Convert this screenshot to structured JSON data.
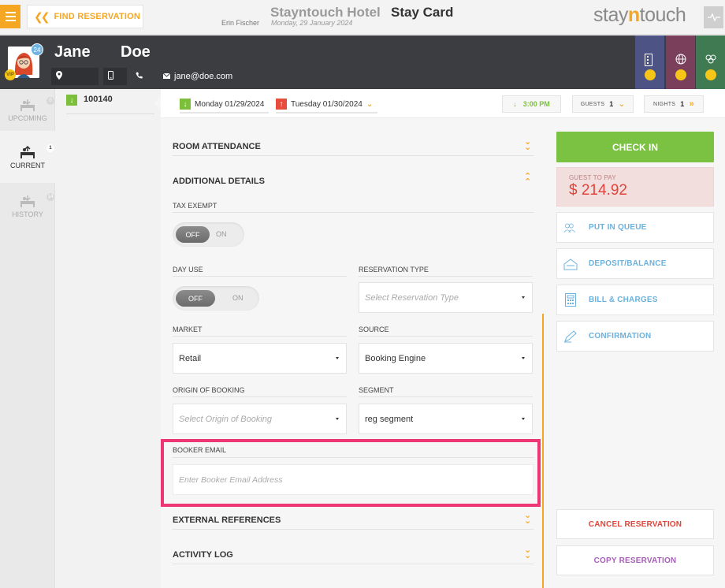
{
  "topbar": {
    "find_reservation": "FIND RESERVATION",
    "hotel_name": "Stayntouch Hotel",
    "page_title": "Stay Card",
    "user_name": "Erin Fischer",
    "current_date": "Monday, 29 January 2024",
    "logo_prefix": "stay",
    "logo_n": "n",
    "logo_suffix": "touch"
  },
  "guest": {
    "first_name": "Jane",
    "last_name": "Doe",
    "email": "jane@doe.com",
    "stay_count": "24",
    "vip": "VIP"
  },
  "sidebar": {
    "items": [
      {
        "label": "UPCOMING",
        "count": "0"
      },
      {
        "label": "CURRENT",
        "count": "1"
      },
      {
        "label": "HISTORY",
        "count": "14"
      }
    ]
  },
  "reservation_list": {
    "number": "100140"
  },
  "datebar": {
    "arrival": "Monday 01/29/2024",
    "departure": "Tuesday 01/30/2024",
    "arrival_time": "3:00 PM",
    "guests_label": "GUESTS",
    "guests_value": "1",
    "nights_label": "NIGHTS",
    "nights_value": "1"
  },
  "sections": {
    "room_attendance": "ROOM ATTENDANCE",
    "additional_details": "ADDITIONAL DETAILS",
    "external_references": "EXTERNAL REFERENCES",
    "activity_log": "ACTIVITY LOG"
  },
  "form": {
    "tax_exempt_label": "TAX EXEMPT",
    "day_use_label": "DAY USE",
    "toggle_off": "OFF",
    "toggle_on": "ON",
    "reservation_type_label": "RESERVATION TYPE",
    "reservation_type_placeholder": "Select Reservation Type",
    "market_label": "MARKET",
    "market_value": "Retail",
    "source_label": "SOURCE",
    "source_value": "Booking Engine",
    "origin_label": "ORIGIN OF BOOKING",
    "origin_placeholder": "Select Origin of Booking",
    "segment_label": "SEGMENT",
    "segment_value": "reg segment",
    "booker_email_label": "BOOKER EMAIL",
    "booker_email_placeholder": "Enter Booker Email Address"
  },
  "actions": {
    "check_in": "CHECK IN",
    "guest_to_pay_label": "GUEST TO PAY",
    "guest_to_pay_amount": "$ 214.92",
    "put_in_queue": "PUT IN QUEUE",
    "deposit_balance": "DEPOSIT/BALANCE",
    "bill_charges": "BILL & CHARGES",
    "confirmation": "CONFIRMATION",
    "cancel_reservation": "CANCEL RESERVATION",
    "copy_reservation": "COPY RESERVATION"
  },
  "colors": {
    "accent": "#f5a623",
    "check_in": "#7bc142",
    "action_blue": "#6cb1dc",
    "cancel_red": "#e0443a",
    "copy_purple": "#a65fb7",
    "highlight": "#ee3673"
  }
}
